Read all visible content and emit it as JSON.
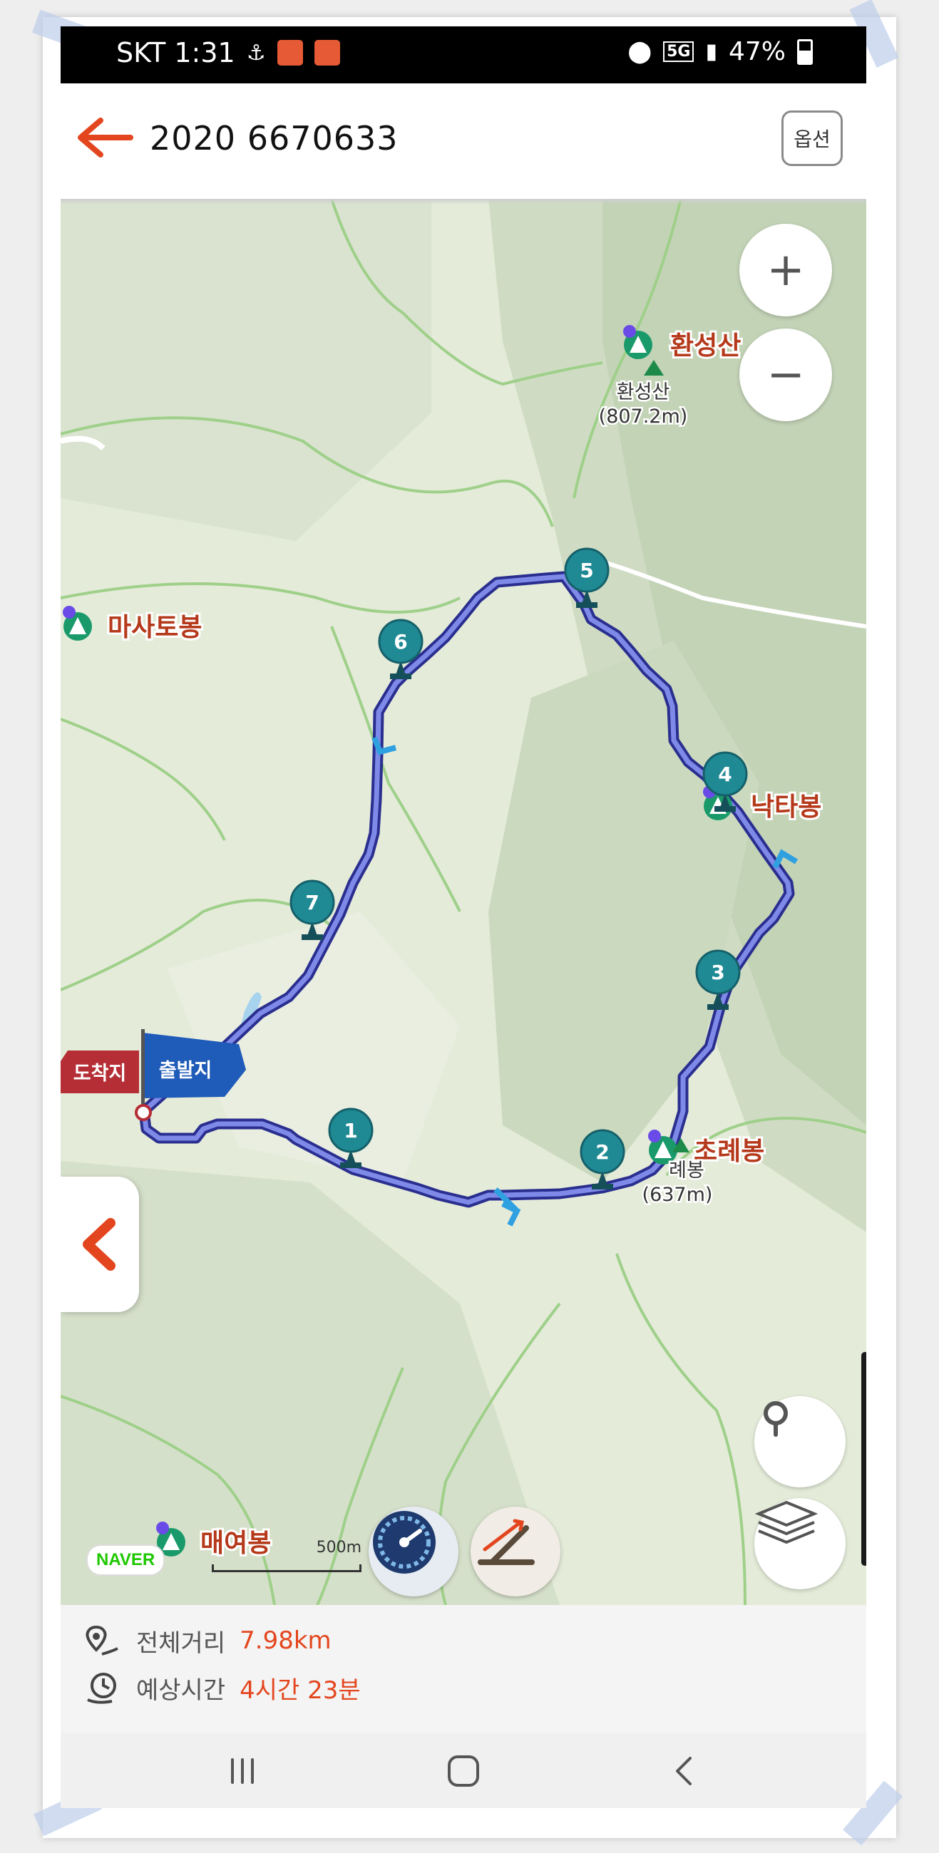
{
  "status_bar": {
    "carrier_time": "SKT 1:31",
    "network": "5G",
    "battery": "47%"
  },
  "app_bar": {
    "title": "2020 6670633",
    "options_label": "옵션"
  },
  "map": {
    "zoom_in": "+",
    "zoom_out": "−",
    "peaks": [
      {
        "name": "환성산",
        "sub_name": "환성산",
        "elevation": "(807.2m)"
      },
      {
        "name": "마사토봉"
      },
      {
        "name": "낙타봉"
      },
      {
        "name": "초례봉",
        "sub_name": "례봉",
        "elevation": "(637m)"
      },
      {
        "name": "매여봉"
      }
    ],
    "waypoints": [
      "1",
      "2",
      "3",
      "4",
      "5",
      "6",
      "7"
    ],
    "flags": {
      "arrival": "도착지",
      "departure": "출발지"
    },
    "provider": "NAVER",
    "scale": "500m"
  },
  "summary": {
    "distance_label": "전체거리",
    "distance_value": "7.98km",
    "time_label": "예상시간",
    "time_value": "4시간 23분"
  },
  "colors": {
    "accent": "#e3461e",
    "route_line": "#4b55c4",
    "waypoint_pin": "#1f8a94",
    "map_base": "#e3ead8"
  }
}
